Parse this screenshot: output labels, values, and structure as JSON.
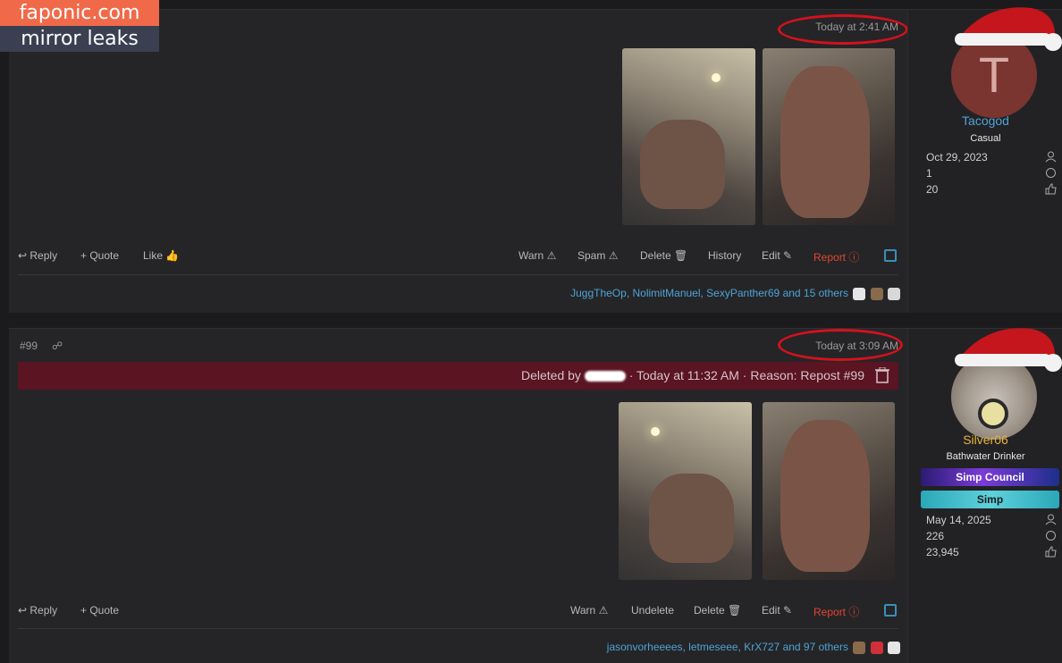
{
  "watermark": {
    "line1": "faponic.com",
    "line2": "mirror leaks"
  },
  "posts": [
    {
      "timestamp": "Today at 2:41 AM",
      "actions": {
        "report": "Report",
        "edit": "Edit",
        "history": "History",
        "delete": "Delete",
        "spam": "Spam",
        "warn": "Warn",
        "like": "Like",
        "quote": "Quote",
        "reply": "Reply"
      },
      "likes_text": "JuggTheOp, NolimitManuel, SexyPanther69 and 15 others",
      "user": {
        "avatar_letter": "T",
        "name": "Tacogod",
        "name_color": "#4ea3d6",
        "title": "Casual",
        "joined": "Oct 29, 2023",
        "messages": "1",
        "reactions": "20"
      }
    },
    {
      "post_number": "#99",
      "timestamp": "Today at 3:09 AM",
      "deleted_notice": {
        "prefix": "Deleted by",
        "suffix": "· Today at 11:32 AM · Reason: Repost #99"
      },
      "actions": {
        "report": "Report",
        "edit": "Edit",
        "delete": "Delete",
        "undelete": "Undelete",
        "warn": "Warn",
        "quote": "Quote",
        "reply": "Reply"
      },
      "likes_text": "jasonvorheeees, letmeseee, KrX727 and 97 others",
      "user": {
        "name": "Silver06",
        "name_color": "#e8b33b",
        "title": "Bathwater Drinker",
        "banners": [
          "Simp Council",
          "Simp"
        ],
        "joined": "May 14, 2025",
        "messages": "226",
        "reactions": "23,945"
      }
    }
  ],
  "colors": {
    "accent": "#4ea3d6",
    "report": "#e0452f",
    "deleted_bg": "#5a1422",
    "annotation_circle": "#d4111d"
  }
}
